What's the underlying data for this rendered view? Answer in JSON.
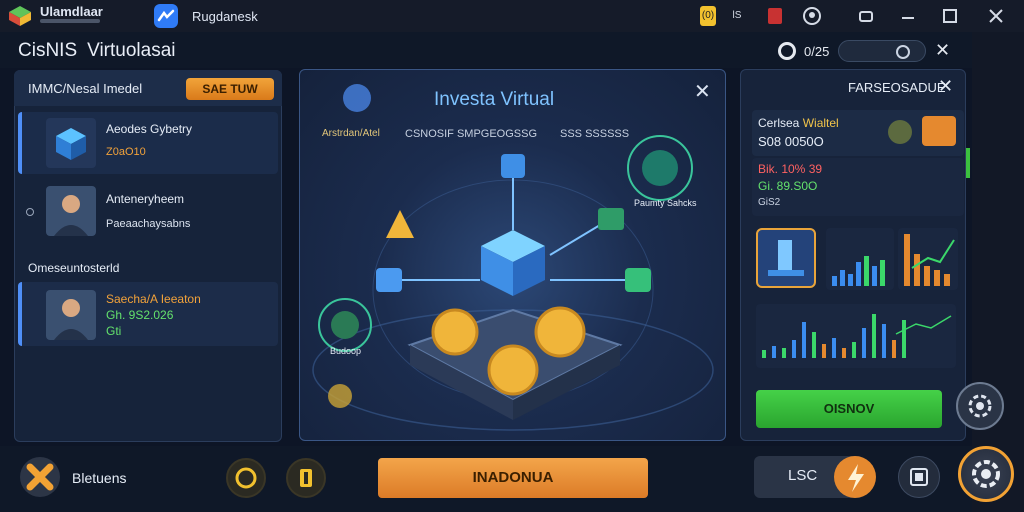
{
  "titlebar": {
    "app_name": "Ulamdlaar",
    "tab_name": "Rugdanesk",
    "indicator": "(0)",
    "indicator_suffix": "lS",
    "buttons": [
      "minimize",
      "maximize",
      "close"
    ]
  },
  "infobar": {
    "title_a": "CisNIS",
    "title_b": "Virtuolasai",
    "timer_value": "0/25"
  },
  "left_panel": {
    "header_title": "IMMC/Nesal Imedel",
    "header_button": "SAE TUW",
    "items": [
      {
        "title": "Aeodes Gybetry",
        "subtitle": "Z0aO10"
      },
      {
        "title": "Anteneryheem",
        "subtitle": "Paeaachaysabns"
      }
    ],
    "section_label": "Omeseuntosterld",
    "featured": {
      "title": "Saecha/A Ieeaton",
      "line1": "Gh. 9S2.026",
      "line2": "Gti"
    }
  },
  "center_panel": {
    "title": "Investa Virtual",
    "brand": "Arstrdan/Atel",
    "tab1": "CSNOSIF SMPGEOGSSG",
    "tab2": "SSS SSSSSS",
    "label_right": "Paumty Sahcks",
    "label_left": "Budoop"
  },
  "right_panel": {
    "title": "FARSEOSADUE",
    "wallet_label_a": "Cerlsea",
    "wallet_label_b": "Wialtel",
    "wallet_value": "S08 0050O",
    "stat_red": "Bik. 10% 39",
    "stat_green": "Gi. 89.S0O",
    "stat_small": "GiS2",
    "action_button": "OISNOV"
  },
  "bottom_bar": {
    "label": "Bletuens",
    "main_button": "INADONUA",
    "lst_label": "LSC"
  },
  "colors": {
    "accent_orange": "#e5892f",
    "accent_green": "#3cc03f",
    "accent_blue": "#4f8ff7",
    "stat_red": "#ff6161",
    "stat_green": "#64e26c"
  }
}
